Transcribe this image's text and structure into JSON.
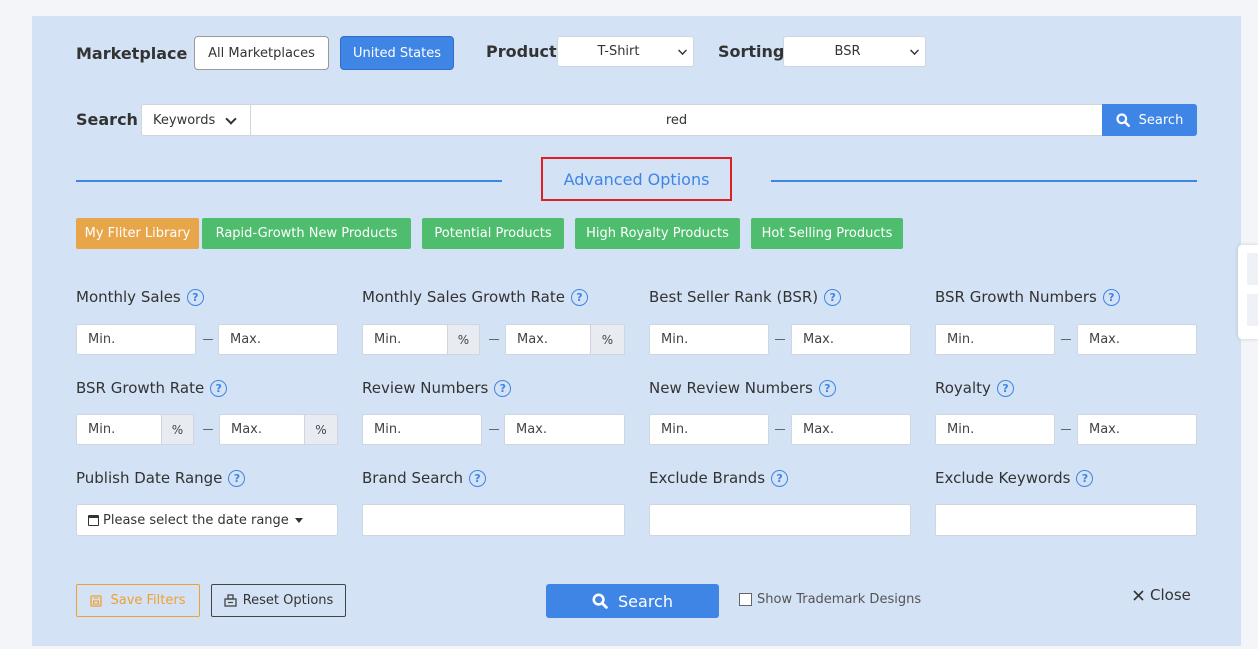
{
  "top": {
    "marketplace_label": "Marketplace",
    "all_marketplaces": "All Marketplaces",
    "united_states": "United States",
    "product_label": "Product",
    "product_value": "T-Shirt",
    "sorting_label": "Sorting",
    "sorting_value": "BSR"
  },
  "search": {
    "label": "Search",
    "type_value": "Keywords",
    "query": "red",
    "button": "Search"
  },
  "advanced": {
    "title": "Advanced Options"
  },
  "presets": [
    "My Fliter Library",
    "Rapid-Growth New Products",
    "Potential Products",
    "High Royalty Products",
    "Hot Selling Products"
  ],
  "filters": {
    "monthly_sales": "Monthly Sales",
    "monthly_sales_growth_rate": "Monthly Sales Growth Rate",
    "best_seller_rank": "Best Seller Rank (BSR)",
    "bsr_growth_numbers": "BSR Growth Numbers",
    "bsr_growth_rate": "BSR Growth Rate",
    "review_numbers": "Review Numbers",
    "new_review_numbers": "New Review Numbers",
    "royalty": "Royalty",
    "publish_date_range": "Publish Date Range",
    "brand_search": "Brand Search",
    "exclude_brands": "Exclude Brands",
    "exclude_keywords": "Exclude Keywords",
    "min": "Min.",
    "max": "Max.",
    "pct": "%",
    "date_placeholder": "Please select the date range"
  },
  "footer": {
    "save_filters": "Save Filters",
    "reset_options": "Reset Options",
    "search": "Search",
    "show_trademark": "Show Trademark Designs",
    "close": "Close"
  },
  "colors": {
    "accent": "#3e85e5",
    "orange": "#e8a64a",
    "green": "#4fbd6e",
    "highlight": "#e02020"
  }
}
